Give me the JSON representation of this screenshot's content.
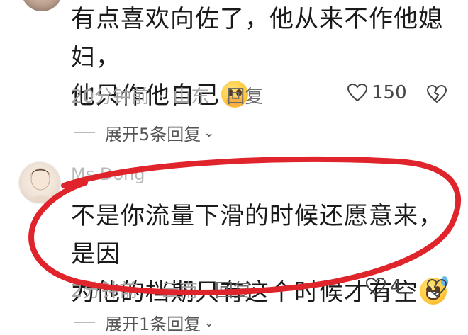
{
  "comments": [
    {
      "text_line1": "有点喜欢向佐了，他从来不作他媳妇，",
      "text_line2": "他只作他自己",
      "emoji": "hands-over-mouth-emoji",
      "time": "20分钟前",
      "location": "山东",
      "reply_label": "回复",
      "likes": "150",
      "expand_label": "展开5条回复"
    },
    {
      "username": "Ms Dong",
      "text_line1": "不是你流量下滑的时候还愿意来，是因",
      "text_line2": "为他的档期只有这个时候才有空",
      "emoji": "grinning-sweat-emoji",
      "time": "2分钟前",
      "location": "云南",
      "reply_label": "回复",
      "likes": "4",
      "expand_label": "展开1条回复"
    }
  ],
  "separator": "·",
  "annotation_color": "#e0242c",
  "icons": [
    "heart-icon",
    "broken-heart-icon",
    "chevron-down-icon"
  ]
}
